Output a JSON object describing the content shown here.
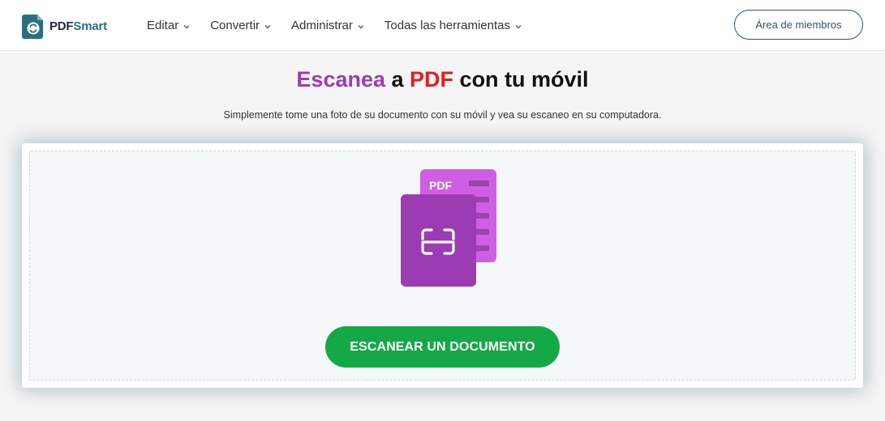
{
  "header": {
    "logo": {
      "text_pdf": "PDF",
      "text_smart": "Smart",
      "icon": "pdfsmart-logo-icon"
    },
    "nav": [
      {
        "label": "Editar",
        "icon": "chevron-down-icon"
      },
      {
        "label": "Convertir",
        "icon": "chevron-down-icon"
      },
      {
        "label": "Administrar",
        "icon": "chevron-down-icon"
      },
      {
        "label": "Todas las herramientas",
        "icon": "chevron-down-icon"
      }
    ],
    "member_button": "Área de miembros"
  },
  "main": {
    "title": {
      "part1": "Escanea",
      "part2": " a ",
      "part3": "PDF",
      "part4": " con tu móvil"
    },
    "subtitle": "Simplemente tome una foto de su documento con su móvil y vea su escaneo en su computadora.",
    "illustration": {
      "badge": "PDF",
      "icon": "scan-document-icon"
    },
    "scan_button": "ESCANEAR UN DOCUMENTO"
  },
  "colors": {
    "accent_purple": "#9b3cb3",
    "accent_red": "#e31e24",
    "button_green": "#14a847",
    "brand_teal": "#2d6f7e"
  }
}
